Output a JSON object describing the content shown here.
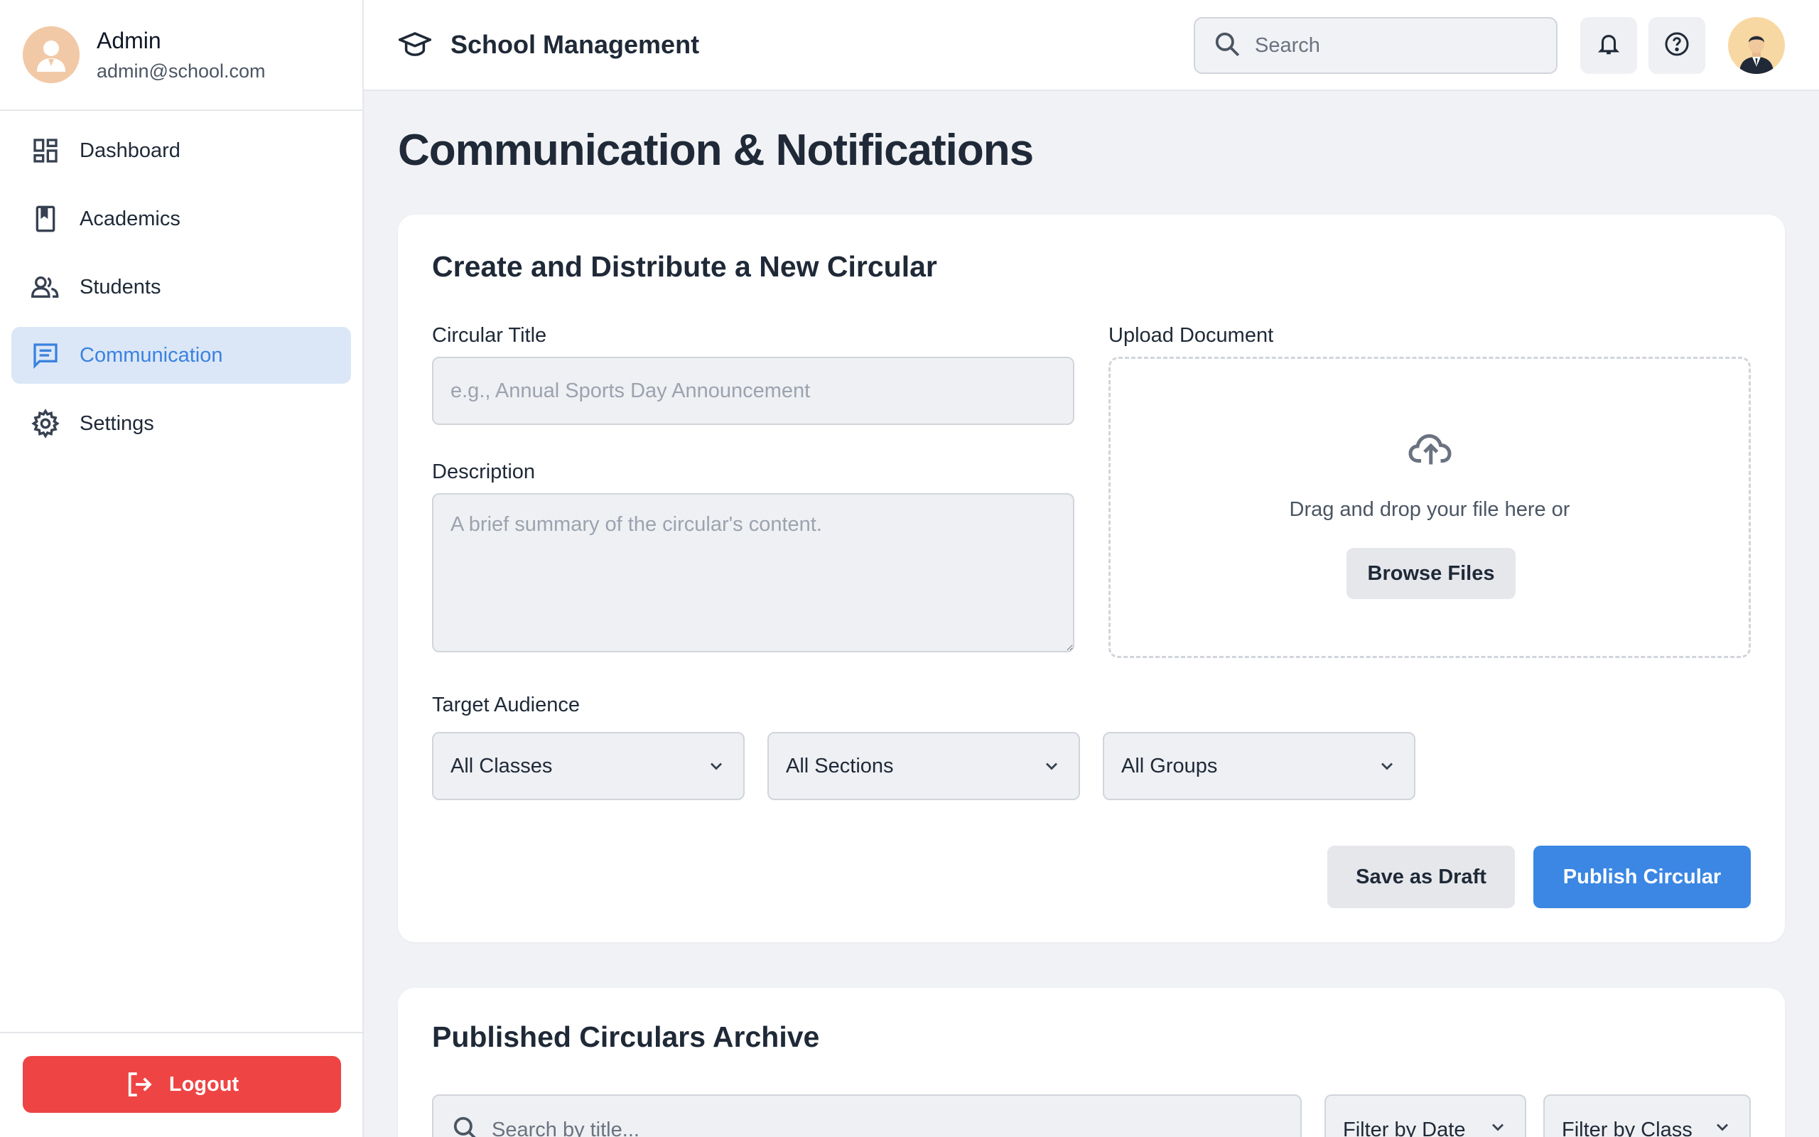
{
  "user": {
    "name": "Admin",
    "email": "admin@school.com"
  },
  "sidebar": {
    "items": [
      {
        "label": "Dashboard",
        "icon": "dashboard-icon"
      },
      {
        "label": "Academics",
        "icon": "book-icon"
      },
      {
        "label": "Students",
        "icon": "users-icon"
      },
      {
        "label": "Communication",
        "icon": "chat-icon",
        "active": true
      },
      {
        "label": "Settings",
        "icon": "gear-icon"
      }
    ],
    "logout_label": "Logout"
  },
  "header": {
    "app_title": "School Management",
    "search_placeholder": "Search"
  },
  "page": {
    "title": "Communication & Notifications"
  },
  "circular_form": {
    "title": "Create and Distribute a New Circular",
    "title_label": "Circular Title",
    "title_placeholder": "e.g., Annual Sports Day Announcement",
    "description_label": "Description",
    "description_placeholder": "A brief summary of the circular's content.",
    "upload_label": "Upload Document",
    "upload_hint": "Drag and drop your file here or",
    "browse_label": "Browse Files",
    "audience_label": "Target Audience",
    "classes_value": "All Classes",
    "sections_value": "All Sections",
    "groups_value": "All Groups",
    "draft_label": "Save as Draft",
    "publish_label": "Publish Circular"
  },
  "archive": {
    "title": "Published Circulars Archive",
    "search_placeholder": "Search by title...",
    "filter_date": "Filter by Date",
    "filter_class": "Filter by Class"
  },
  "colors": {
    "accent": "#3b87e3",
    "active_bg": "#dbe7f7",
    "danger": "#ef4444"
  }
}
